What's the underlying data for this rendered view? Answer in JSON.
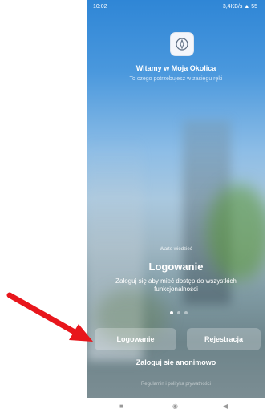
{
  "status_bar": {
    "time": "10:02",
    "net_speed": "3,4KB/s",
    "battery": "55"
  },
  "app": {
    "welcome": "Witamy w Moja Okolica",
    "tagline": "To czego potrzebujesz w zasięgu ręki"
  },
  "slide": {
    "kicker": "Warto wiedzieć",
    "title": "Logowanie",
    "description": "Zaloguj się aby mieć dostęp do wszystkich funkcjonalności"
  },
  "buttons": {
    "login": "Logowanie",
    "register": "Rejestracja",
    "anonymous": "Zaloguj się anonimowo"
  },
  "footer": {
    "terms": "Regulamin i polityka prywatności"
  },
  "colors": {
    "arrow": "#e8161c"
  }
}
